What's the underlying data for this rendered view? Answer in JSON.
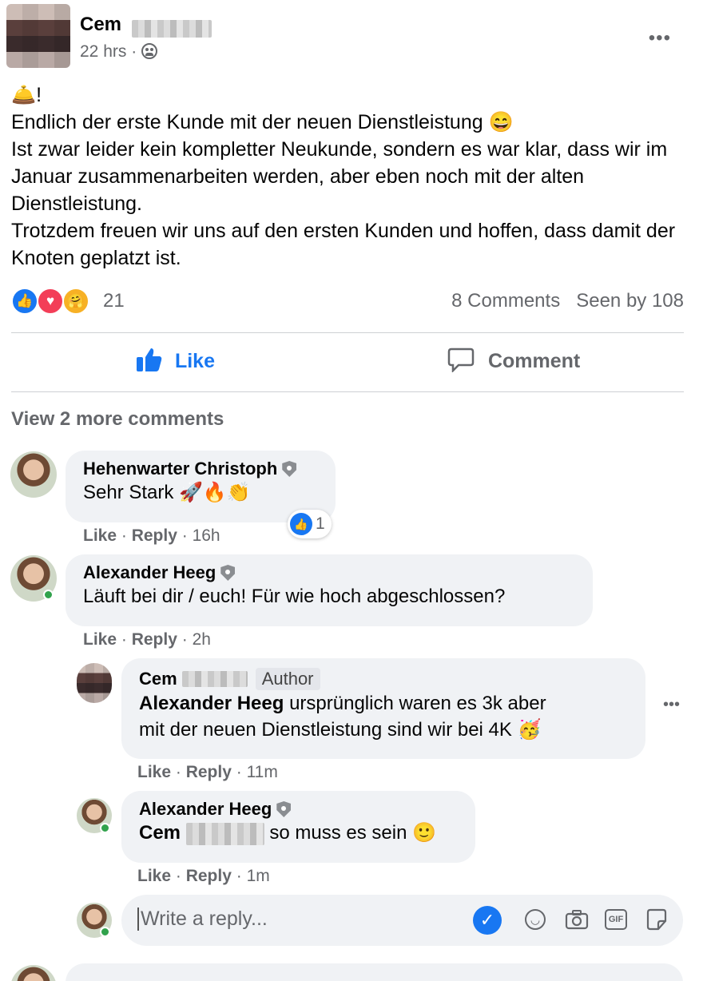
{
  "post": {
    "author": "Cem",
    "time": "22 hrs · ",
    "privacy_icon": "friends-icon",
    "body_lines": [
      "🛎️!",
      "Endlich der erste Kunde mit der neuen Dienstleistung 😄",
      "Ist zwar leider kein kompletter Neukunde, sondern es war klar, dass wir im Januar zusammenarbeiten werden, aber eben noch mit der alten Dienstleistung.",
      "Trotzdem freuen wir uns auf den ersten Kunden und hoffen, dass damit der Knoten geplatzt ist."
    ],
    "reaction_count": "21",
    "comments_count": "8 Comments",
    "seen_by": "Seen by 108"
  },
  "actions": {
    "like": "Like",
    "comment": "Comment"
  },
  "view_more": "View 2 more comments",
  "comments": [
    {
      "name": "Hehenwarter Christoph",
      "text": "Sehr Stark 🚀🔥👏",
      "like": "Like",
      "reply": "Reply",
      "time": "16h",
      "reaction_count": "1"
    },
    {
      "name": "Alexander Heeg",
      "text": "Läuft bei dir / euch! Für wie hoch abgeschlossen?",
      "like": "Like",
      "reply": "Reply",
      "time": "2h"
    }
  ],
  "replies": [
    {
      "name": "Cem",
      "badge": "Author",
      "mention": "Alexander Heeg",
      "text_line1": " ursprünglich waren es 3k aber",
      "text_line2": "mit der neuen Dienstleistung sind wir bei 4K 🥳",
      "like": "Like",
      "reply": "Reply",
      "time": "11m"
    },
    {
      "name": "Alexander Heeg",
      "mention": "Cem",
      "text": "so muss es sein 🙂",
      "like": "Like",
      "reply": "Reply",
      "time": "1m"
    }
  ],
  "reply_box": {
    "placeholder": "Write a reply..."
  },
  "colors": {
    "accent": "#1877f2",
    "secondary_text": "#65676b",
    "bubble": "#f0f2f5",
    "online": "#31a24c"
  }
}
